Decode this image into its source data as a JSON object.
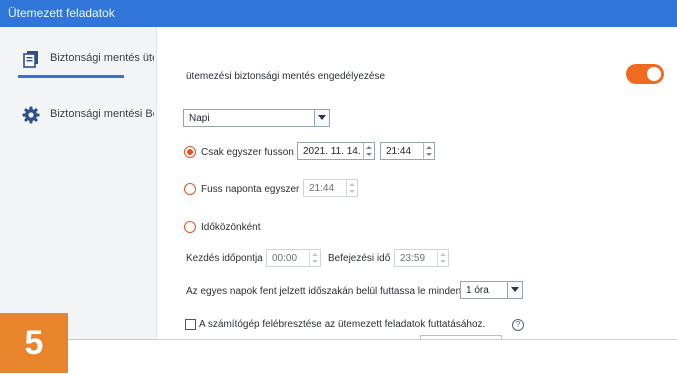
{
  "window": {
    "title": "Ütemezett feladatok"
  },
  "sidebar": {
    "items": [
      {
        "label": "Biztonsági mentés ütemezése",
        "icon": "backup-copy-icon",
        "active": true
      },
      {
        "label": "Biztonsági mentési Beállítások",
        "icon": "gear-icon",
        "active": false
      }
    ]
  },
  "main": {
    "enable_label": "ütemezési biztonsági mentés engedélyezése",
    "enable_toggle": {
      "on": true
    },
    "frequency": {
      "value": "Napi"
    },
    "once": {
      "label": "Csak egyszer fusson",
      "date": "2021. 11. 14.",
      "time": "21:44",
      "selected": true
    },
    "daily": {
      "label": "Fuss naponta egyszer",
      "time": "21:44",
      "selected": false
    },
    "interval": {
      "label": "Időközönként",
      "selected": false,
      "start_label": "Kezdés időpontja",
      "start_value": "00:00",
      "end_label": "Befejezési idő",
      "end_value": "23:59",
      "repeat_label": "Az egyes napok fent jelzett időszakán belül futtassa le minden",
      "repeat_value": "1 óra"
    },
    "wake": {
      "label": "A számítógép felébresztése az ütemezett feladatok futtatásához.",
      "checked": false,
      "help_glyph": "?"
    }
  },
  "badge": {
    "text": "5"
  },
  "colors": {
    "accent": "#2f76d8",
    "toggle": "#f06a20",
    "radio": "#e8531f",
    "badge": "#e8842b"
  }
}
